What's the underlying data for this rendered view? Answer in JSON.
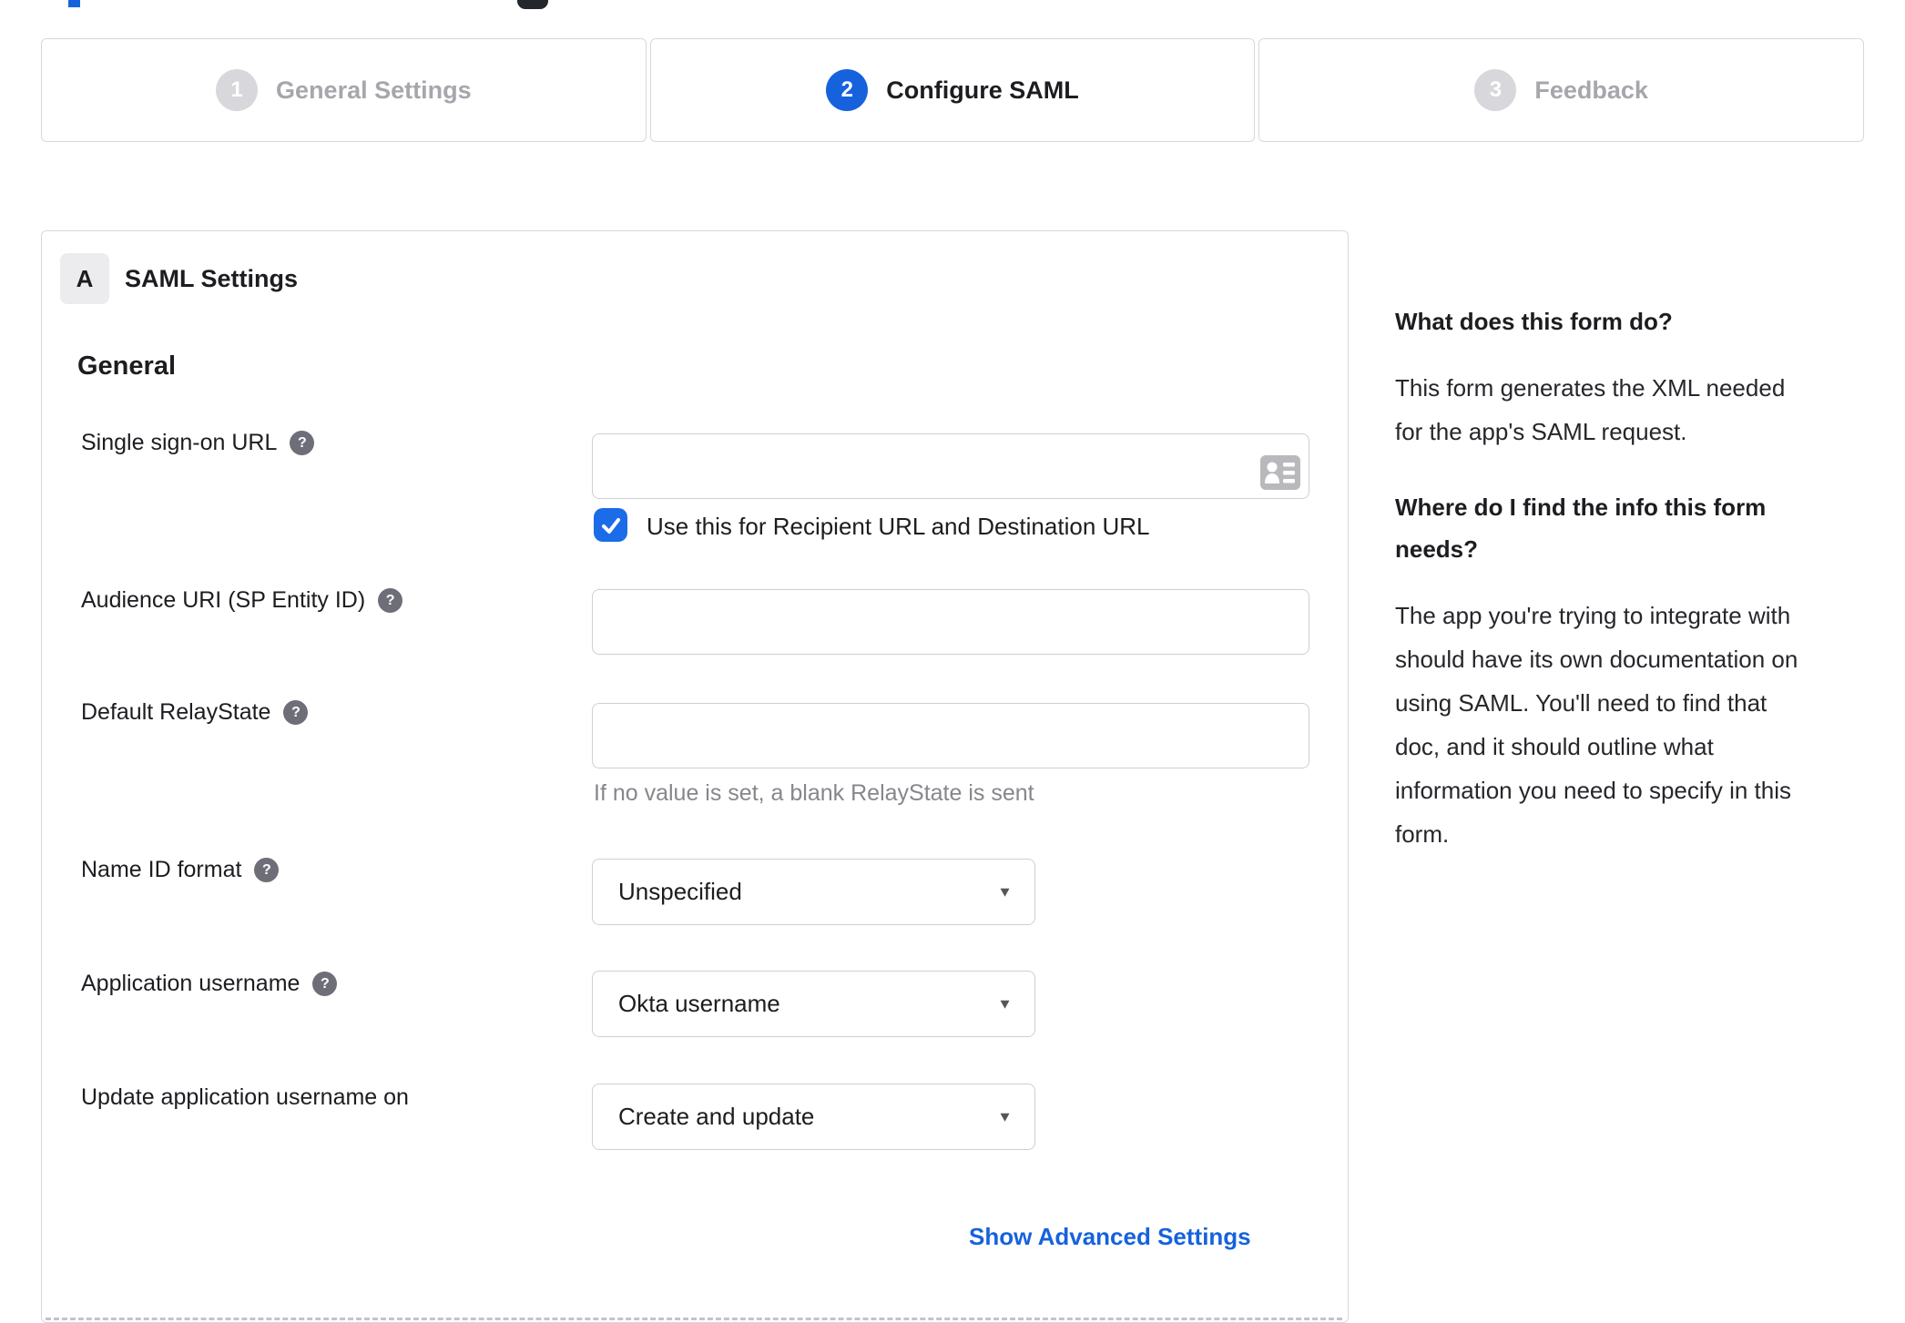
{
  "stepper": {
    "steps": [
      {
        "number": "1",
        "label": "General Settings",
        "state": "inactive"
      },
      {
        "number": "2",
        "label": "Configure SAML",
        "state": "active"
      },
      {
        "number": "3",
        "label": "Feedback",
        "state": "inactive"
      }
    ]
  },
  "panel": {
    "badge": "A",
    "title": "SAML Settings",
    "section_heading": "General",
    "help_glyph": "?",
    "fields": {
      "sso": {
        "label": "Single sign-on URL",
        "value": "",
        "checkbox_label": "Use this for Recipient URL and Destination URL",
        "checkbox_checked": true
      },
      "audience": {
        "label": "Audience URI (SP Entity ID)",
        "value": ""
      },
      "relay": {
        "label": "Default RelayState",
        "value": "",
        "hint": "If no value is set, a blank RelayState is sent"
      },
      "nameid": {
        "label": "Name ID format",
        "value": "Unspecified"
      },
      "appuser": {
        "label": "Application username",
        "value": "Okta username"
      },
      "update": {
        "label": "Update application username on",
        "value": "Create and update"
      }
    },
    "caret_glyph": "▼",
    "advanced_link": "Show Advanced Settings"
  },
  "sidebar": {
    "q1": "What does this form do?",
    "a1": {
      "lines": [
        "This form generates the XML needed",
        "for the app's SAML request."
      ]
    },
    "q2": {
      "lines": [
        "Where do I find the info this form",
        "needs?"
      ]
    },
    "a2": {
      "lines": [
        "The app you're trying to integrate with",
        "should have its own documentation on",
        "using SAML. You'll need to find that",
        "doc, and it should outline what",
        "information you need to specify in this",
        "form."
      ]
    }
  },
  "colors": {
    "accent_blue": "#1662dd",
    "checkbox_blue": "#1b6ce8",
    "inactive_gray": "#d8d8dc",
    "inactive_label": "#a6a6ac",
    "border_gray": "#cfcfd4",
    "help_icon_gray": "#6e6e78",
    "hint_gray": "#86868c",
    "text_dark": "#1d1d21"
  }
}
